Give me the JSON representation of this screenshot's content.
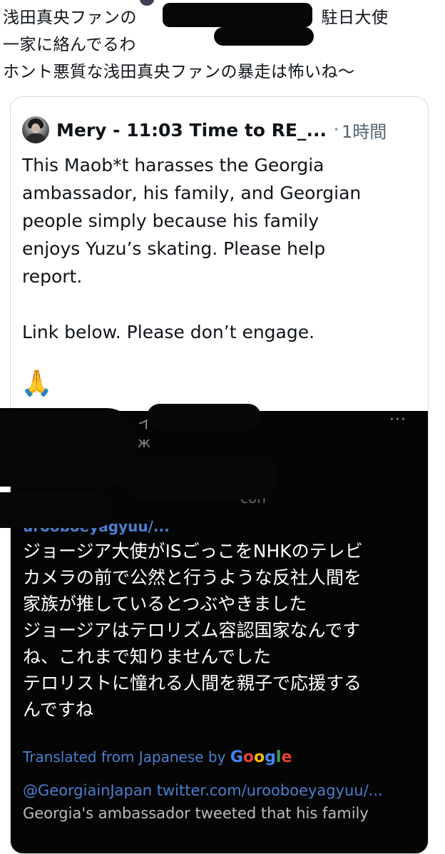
{
  "outer_tweet": {
    "text": "浅田真央ファンの　　　　　　　　さん、駐日大使\n一家に絡んでるわ\nホント悪質な浅田真央ファンの暴走は怖いね〜"
  },
  "quoted_tweet": {
    "display_name": "Mery - 11:03 Time to RE_...",
    "separator": "·",
    "time_ago": "1時間",
    "body": "This Maob*t harasses the Georgia\nambassador, his family, and Georgian\npeople simply because his family\nenjoys Yuzu’s skating. Please help\nreport.\n\nLink below. Please don’t engage.",
    "emoji": "🙏"
  },
  "media": {
    "more_glyph": "···",
    "ghost_char_1": "イ",
    "ghost_char_2": "ж",
    "ghost_text_3": "con",
    "handle_partial": "urooboeyagyuu/...",
    "translated_text": "ジョージア大使がISごっこをNHKのテレビ\nカメラの前で公然と行うような反社人間を\n家族が推しているとつぶやきました\nジョージアはテロリズム容認国家なんです\nね、これまで知りませんでした\nテロリストに憧れる人間を親子で応援する\nんですね",
    "translated_from": "Translated from Japanese by ",
    "google": "Google",
    "link": "@GeorgiainJapan twitter.com/urooboeyagyuu/...",
    "cut_line": "Georgia's ambassador tweeted that his family"
  },
  "colors": {
    "link": "#4a7fd0",
    "border": "#cfd9de",
    "secondary_text": "#536471",
    "google_blue": "#4285f4",
    "google_red": "#ea4335",
    "google_yellow": "#fbbc05",
    "google_green": "#34a853"
  }
}
